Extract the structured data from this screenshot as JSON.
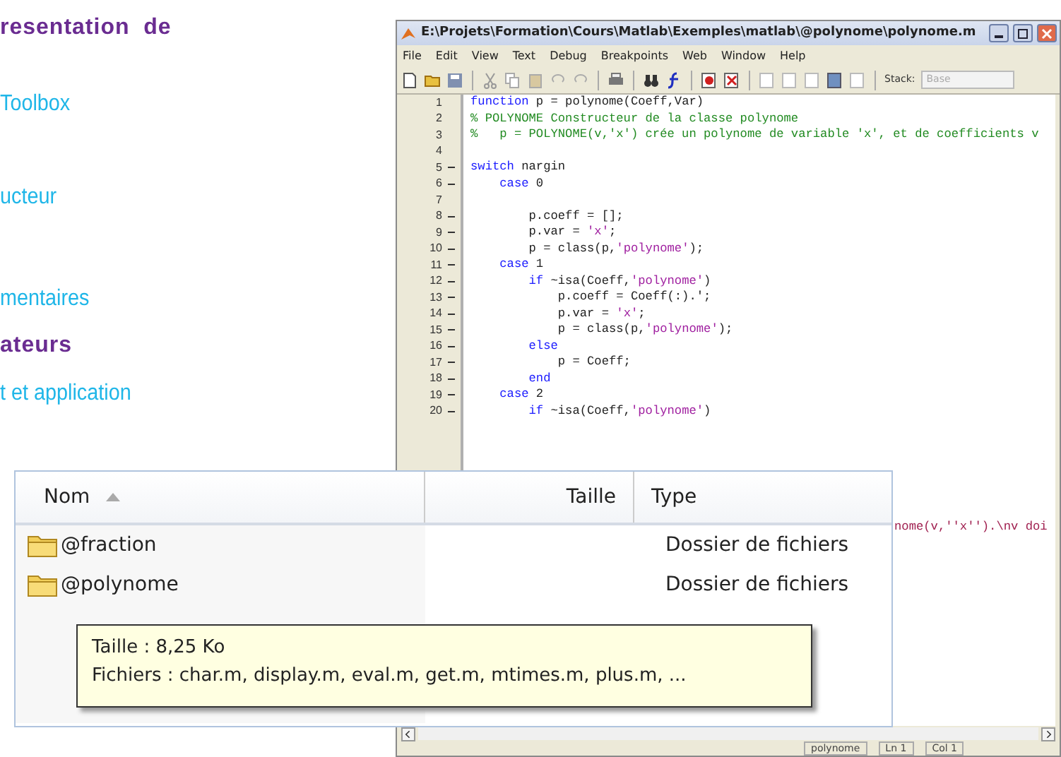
{
  "slide_text": [
    {
      "kind": "heading",
      "text": "resentation  de"
    },
    {
      "kind": "bullet",
      "text": "Toolbox"
    },
    {
      "kind": "bullet",
      "text": "ucteur"
    },
    {
      "kind": "bullet",
      "text": "mentaires"
    },
    {
      "kind": "heading",
      "text": "ateurs"
    },
    {
      "kind": "bullet",
      "text": "t et application"
    }
  ],
  "editor": {
    "title": "E:\\Projets\\Formation\\Cours\\Matlab\\Exemples\\matlab\\@polynome\\polynome.m",
    "menu": [
      "File",
      "Edit",
      "View",
      "Text",
      "Debug",
      "Breakpoints",
      "Web",
      "Window",
      "Help"
    ],
    "stack_label": "Stack:",
    "stack_value": "Base",
    "stack_disabled": true,
    "lines": [
      {
        "num": "1",
        "executable": false,
        "segments": [
          {
            "kind": "keyword",
            "text": "function"
          },
          {
            "kind": "plain",
            "text": " p = polynome(Coeff,Var)"
          }
        ]
      },
      {
        "num": "2",
        "executable": false,
        "segments": [
          {
            "kind": "comment",
            "text": "% POLYNOME Constructeur de la classe polynome"
          }
        ]
      },
      {
        "num": "3",
        "executable": false,
        "segments": [
          {
            "kind": "comment",
            "text": "%   p = POLYNOME(v,'x') crée un polynome de variable 'x', et de coefficients v"
          }
        ]
      },
      {
        "num": "4",
        "executable": false
      },
      {
        "num": "5",
        "executable": true,
        "segments": [
          {
            "kind": "keyword",
            "text": "switch"
          },
          {
            "kind": "plain",
            "text": " nargin"
          }
        ]
      },
      {
        "num": "6",
        "executable": true,
        "segments": [
          {
            "kind": "keyword",
            "text": "    case"
          },
          {
            "kind": "plain",
            "text": " 0"
          }
        ]
      },
      {
        "num": "7",
        "executable": false
      },
      {
        "num": "8",
        "executable": true,
        "segments": [
          {
            "kind": "plain",
            "text": "        p.coeff = [];"
          }
        ]
      },
      {
        "num": "9",
        "executable": true,
        "segments": [
          {
            "kind": "plain",
            "text": "        p.var = "
          },
          {
            "kind": "string",
            "text": "'x'"
          },
          {
            "kind": "plain",
            "text": ";"
          }
        ]
      },
      {
        "num": "10",
        "executable": true,
        "segments": [
          {
            "kind": "plain",
            "text": "        p = class(p,"
          },
          {
            "kind": "string",
            "text": "'polynome'"
          },
          {
            "kind": "plain",
            "text": ");"
          }
        ]
      },
      {
        "num": "11",
        "executable": true,
        "segments": [
          {
            "kind": "keyword",
            "text": "    case"
          },
          {
            "kind": "plain",
            "text": " 1"
          }
        ]
      },
      {
        "num": "12",
        "executable": true,
        "segments": [
          {
            "kind": "keyword",
            "text": "        if"
          },
          {
            "kind": "plain",
            "text": " ~isa(Coeff,"
          },
          {
            "kind": "string",
            "text": "'polynome'"
          },
          {
            "kind": "plain",
            "text": ")"
          }
        ]
      },
      {
        "num": "13",
        "executable": true,
        "segments": [
          {
            "kind": "plain",
            "text": "            p.coeff = Coeff(:).';"
          }
        ]
      },
      {
        "num": "14",
        "executable": true,
        "segments": [
          {
            "kind": "plain",
            "text": "            p.var = "
          },
          {
            "kind": "string",
            "text": "'x'"
          },
          {
            "kind": "plain",
            "text": ";"
          }
        ]
      },
      {
        "num": "15",
        "executable": true,
        "segments": [
          {
            "kind": "plain",
            "text": "            p = class(p,"
          },
          {
            "kind": "string",
            "text": "'polynome'"
          },
          {
            "kind": "plain",
            "text": ");"
          }
        ]
      },
      {
        "num": "16",
        "executable": true,
        "segments": [
          {
            "kind": "keyword",
            "text": "        else"
          }
        ]
      },
      {
        "num": "17",
        "executable": true,
        "segments": [
          {
            "kind": "plain",
            "text": "            p = Coeff;"
          }
        ]
      },
      {
        "num": "18",
        "executable": true,
        "segments": [
          {
            "kind": "keyword",
            "text": "        end"
          }
        ]
      },
      {
        "num": "19",
        "executable": true,
        "segments": [
          {
            "kind": "keyword",
            "text": "    case"
          },
          {
            "kind": "plain",
            "text": " 2"
          }
        ]
      },
      {
        "num": "20",
        "executable": true,
        "segments": [
          {
            "kind": "keyword",
            "text": "        if"
          },
          {
            "kind": "plain",
            "text": " ~isa(Coeff,"
          },
          {
            "kind": "string",
            "text": "'polynome'"
          },
          {
            "kind": "plain",
            "text": ")"
          }
        ]
      }
    ],
    "partial_line": "nome(v,''x'').\\nv doi",
    "status": {
      "function": "polynome",
      "line": "Ln 1",
      "column": "Col 1"
    }
  },
  "explorer": {
    "columns": [
      {
        "label": "Nom",
        "sorted": true
      },
      {
        "label": "Taille",
        "sorted": false
      },
      {
        "label": "Type",
        "sorted": false
      }
    ],
    "rows": [
      {
        "name": "@fraction",
        "type": "Dossier de fichiers"
      },
      {
        "name": "@polynome",
        "type": "Dossier de fichiers"
      }
    ],
    "tooltip": [
      "Taille : 8,25 Ko",
      "Fichiers : char.m, display.m, eval.m, get.m, mtimes.m, plus.m, ..."
    ]
  }
}
